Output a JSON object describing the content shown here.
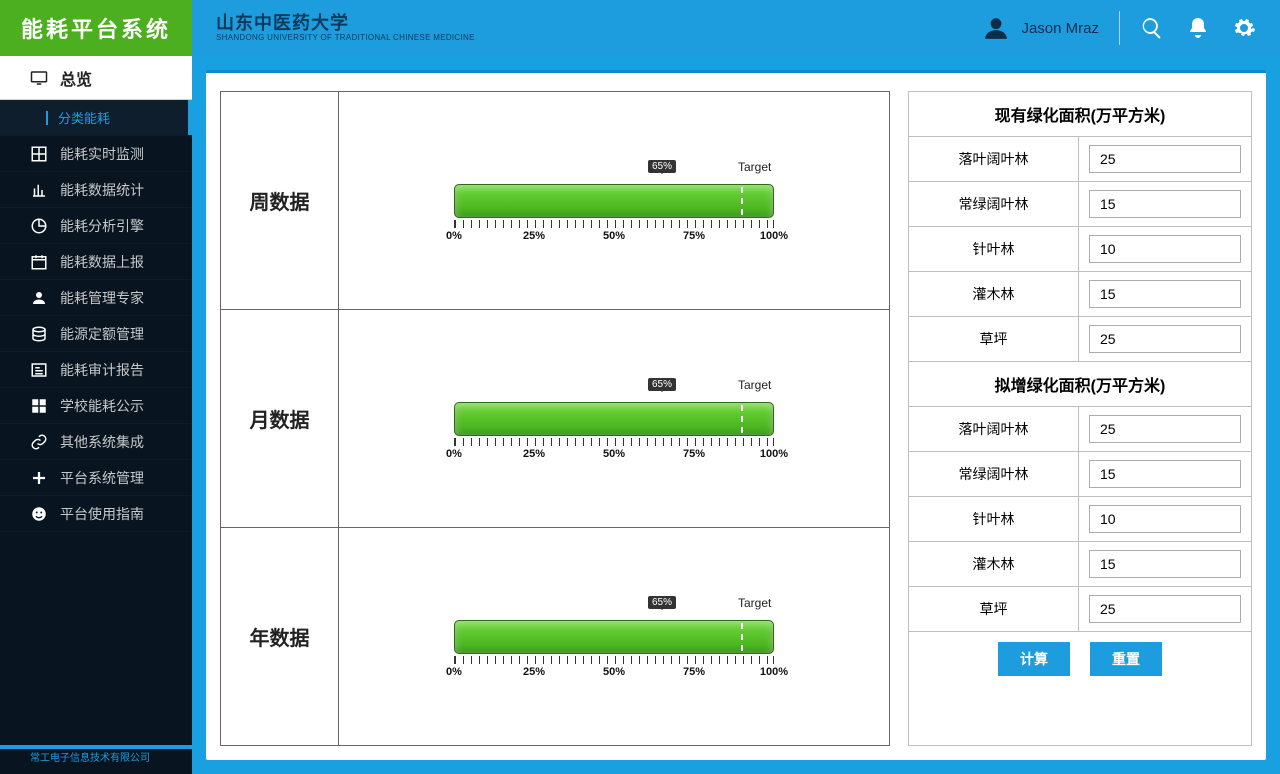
{
  "brand": "能耗平台系统",
  "university": {
    "cn": "山东中医药大学",
    "en": "SHANDONG UNIVERSITY OF TRADITIONAL CHINESE MEDICINE"
  },
  "user": "Jason Mraz",
  "footer": "常工电子信息技术有限公司",
  "sidebar": {
    "top": "总览",
    "sub": "分类能耗",
    "items": [
      "能耗实时监测",
      "能耗数据统计",
      "能耗分析引擎",
      "能耗数据上报",
      "能耗管理专家",
      "能源定额管理",
      "能耗审计报告",
      "学校能耗公示",
      "其他系统集成",
      "平台系统管理",
      "平台使用指南"
    ]
  },
  "chart_data": [
    {
      "label": "周数据",
      "type": "bar",
      "value_pct": 100,
      "marker_pct": 65,
      "marker_text": "65%",
      "target_pct": 90,
      "target_label": "Target",
      "ticks": [
        "0%",
        "25%",
        "50%",
        "75%",
        "100%"
      ]
    },
    {
      "label": "月数据",
      "type": "bar",
      "value_pct": 100,
      "marker_pct": 65,
      "marker_text": "65%",
      "target_pct": 90,
      "target_label": "Target",
      "ticks": [
        "0%",
        "25%",
        "50%",
        "75%",
        "100%"
      ]
    },
    {
      "label": "年数据",
      "type": "bar",
      "value_pct": 100,
      "marker_pct": 65,
      "marker_text": "65%",
      "target_pct": 90,
      "target_label": "Target",
      "ticks": [
        "0%",
        "25%",
        "50%",
        "75%",
        "100%"
      ]
    }
  ],
  "form": {
    "section1_title": "现有绿化面积(万平方米)",
    "section2_title": "拟增绿化面积(万平方米)",
    "rows1": [
      {
        "label": "落叶阔叶林",
        "value": "25"
      },
      {
        "label": "常绿阔叶林",
        "value": "15"
      },
      {
        "label": "针叶林",
        "value": "10"
      },
      {
        "label": "灌木林",
        "value": "15"
      },
      {
        "label": "草坪",
        "value": "25"
      }
    ],
    "rows2": [
      {
        "label": "落叶阔叶林",
        "value": "25"
      },
      {
        "label": "常绿阔叶林",
        "value": "15"
      },
      {
        "label": "针叶林",
        "value": "10"
      },
      {
        "label": "灌木林",
        "value": "15"
      },
      {
        "label": "草坪",
        "value": "25"
      }
    ],
    "btn_calc": "计算",
    "btn_reset": "重置"
  }
}
